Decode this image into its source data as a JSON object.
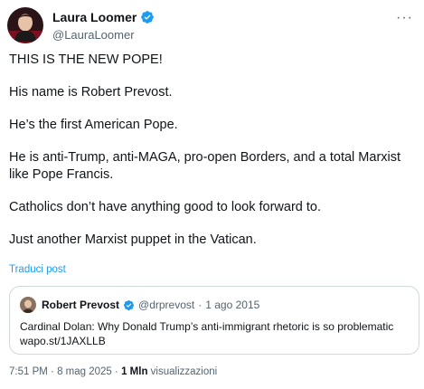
{
  "author": {
    "name": "Laura Loomer",
    "handle": "@LauraLoomer"
  },
  "tweet": {
    "paragraphs": [
      "THIS IS THE NEW POPE!",
      "His name is Robert Prevost.",
      "He’s the first American Pope.",
      "He is anti-Trump, anti-MAGA, pro-open Borders, and a total Marxist like Pope Francis.",
      "Catholics don’t have anything good to look forward to.",
      "Just another Marxist puppet in the Vatican."
    ],
    "translate_label": "Traduci post"
  },
  "quote": {
    "name": "Robert Prevost",
    "handle": "@drprevost",
    "separator": "·",
    "date": "1 ago 2015",
    "text_line1": "Cardinal Dolan: Why Donald Trump’s anti-immigrant rhetoric is so problematic",
    "text_line2": "wapo.st/1JAXLLB"
  },
  "footer": {
    "time": "7:51 PM",
    "dot": "·",
    "date": "8 mag 2025",
    "views_count": "1 Mln",
    "views_label": "visualizzazioni"
  },
  "icons": {
    "verified": "verified-badge-icon",
    "more": "more-options-icon"
  },
  "colors": {
    "accent": "#1d9bf0",
    "text": "#0f1419",
    "secondary": "#536471",
    "border": "#cfd9de"
  }
}
